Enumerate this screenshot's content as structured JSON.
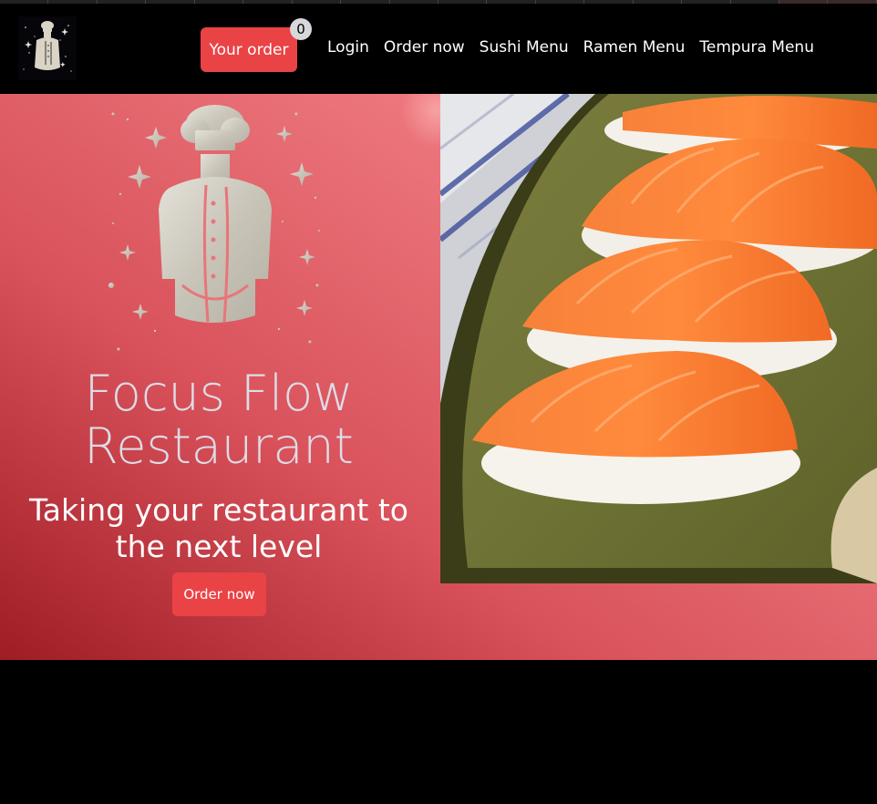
{
  "header": {
    "order_button_label": "Your order",
    "order_count": "0",
    "nav_links": [
      "Login",
      "Order now",
      "Sushi Menu",
      "Ramen Menu",
      "Tempura Menu"
    ]
  },
  "hero": {
    "title": "Focus Flow Restaurant",
    "subtitle": "Taking your restaurant to the next level",
    "cta_label": "Order now"
  },
  "icons": {
    "logo": "chef-logo-icon",
    "hero_art": "chef-illustration-icon",
    "photo": "salmon-nigiri-photo"
  },
  "colors": {
    "accent": "#ea4346",
    "hero_dark": "#a01c25",
    "hero_light": "#f08484",
    "title_text": "#dcdde6",
    "background": "#000000"
  }
}
